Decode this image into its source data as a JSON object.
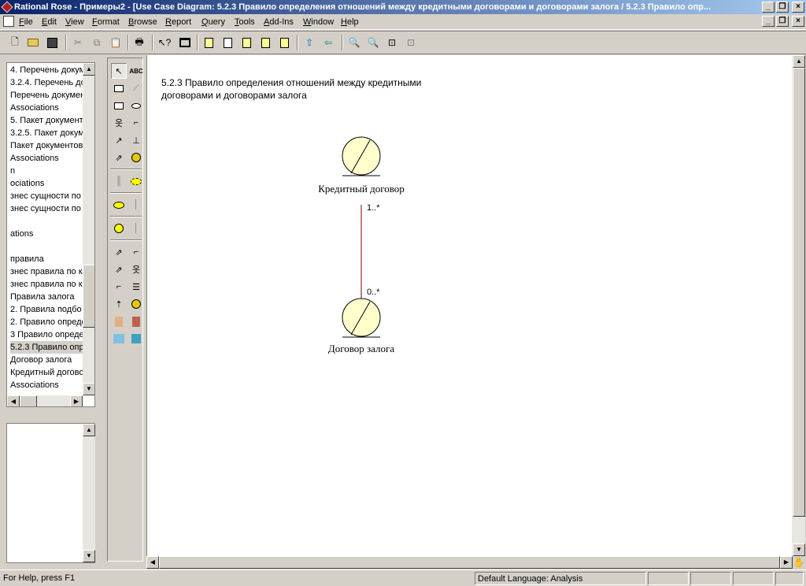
{
  "window": {
    "title": "Rational Rose - Примеры2 - [Use Case Diagram: 5.2.3 Правило определения отношений между кредитными договорами и договорами залога / 5.2.3 Правило опр..."
  },
  "menu": [
    "File",
    "Edit",
    "View",
    "Format",
    "Browse",
    "Report",
    "Query",
    "Tools",
    "Add-Ins",
    "Window",
    "Help"
  ],
  "browser": {
    "items": [
      "4. Перечень докум",
      "3.2.4. Перечень до",
      "Перечень докумен",
      "Associations",
      "5. Пакет документ",
      "3.2.5. Пакет докум",
      "Пакет документов",
      "Associations",
      "n",
      "ociations",
      "знес сущности по н",
      "знес сущности по н",
      "",
      "ations",
      "",
      "правила",
      "знес правила по кр",
      "знес правила по кр",
      "Правила залога",
      "2.  Правила подбо",
      "2. Правило опреде",
      "3 Правило опреде",
      "5.2.3 Правило опр",
      "Договор залога",
      "Кредитный догово",
      "Associations"
    ],
    "selected_index": 22
  },
  "diagram": {
    "title": "5.2.3 Правило определения отношений между кредитными договорами и договорами залога",
    "title_line1": "5.2.3 Правило определения отношений между кредитными",
    "title_line2": "договорами и договорами залога",
    "entity_top": "Кредитный договор",
    "entity_bottom": "Договор залога",
    "multiplicity_top": "1..*",
    "multiplicity_bottom": "0..*"
  },
  "status": {
    "help": "For Help, press F1",
    "language": "Default Language: Analysis"
  },
  "colors": {
    "entity_fill": "#ffffcc",
    "association_line": "#800000",
    "selection_bg": "#d4d0c8"
  }
}
